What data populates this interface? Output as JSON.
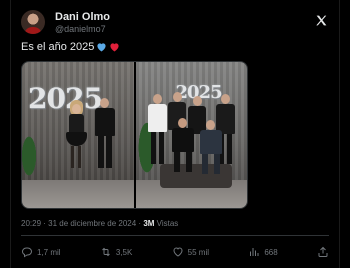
{
  "tweet": {
    "author_name": "Dani Olmo",
    "author_handle": "@danielmo7",
    "text": "Es el año 2025",
    "emoji": [
      "blue-heart",
      "red-heart"
    ],
    "timestamp": "20:29 · 31 de diciembre de 2024 · ",
    "views_count": "3M",
    "views_label": " Vistas",
    "photos": [
      {
        "balloons": "2025"
      },
      {
        "balloons": "2025"
      }
    ]
  },
  "actions": {
    "replies": "1,7 mil",
    "reposts": "3,5K",
    "likes": "55 mil",
    "bookmarks": "",
    "views": "668"
  },
  "icons": {
    "brand": "x-logo-icon",
    "reply": "reply-icon",
    "repost": "repost-icon",
    "like": "heart-icon",
    "bookmark": "bookmark-icon",
    "share": "share-icon"
  },
  "colors": {
    "background": "#000000",
    "text": "#e7e9ea",
    "muted": "#71767b",
    "border": "#2f3336",
    "blue_heart": "#1d9bf0",
    "red_heart": "#f91880"
  }
}
